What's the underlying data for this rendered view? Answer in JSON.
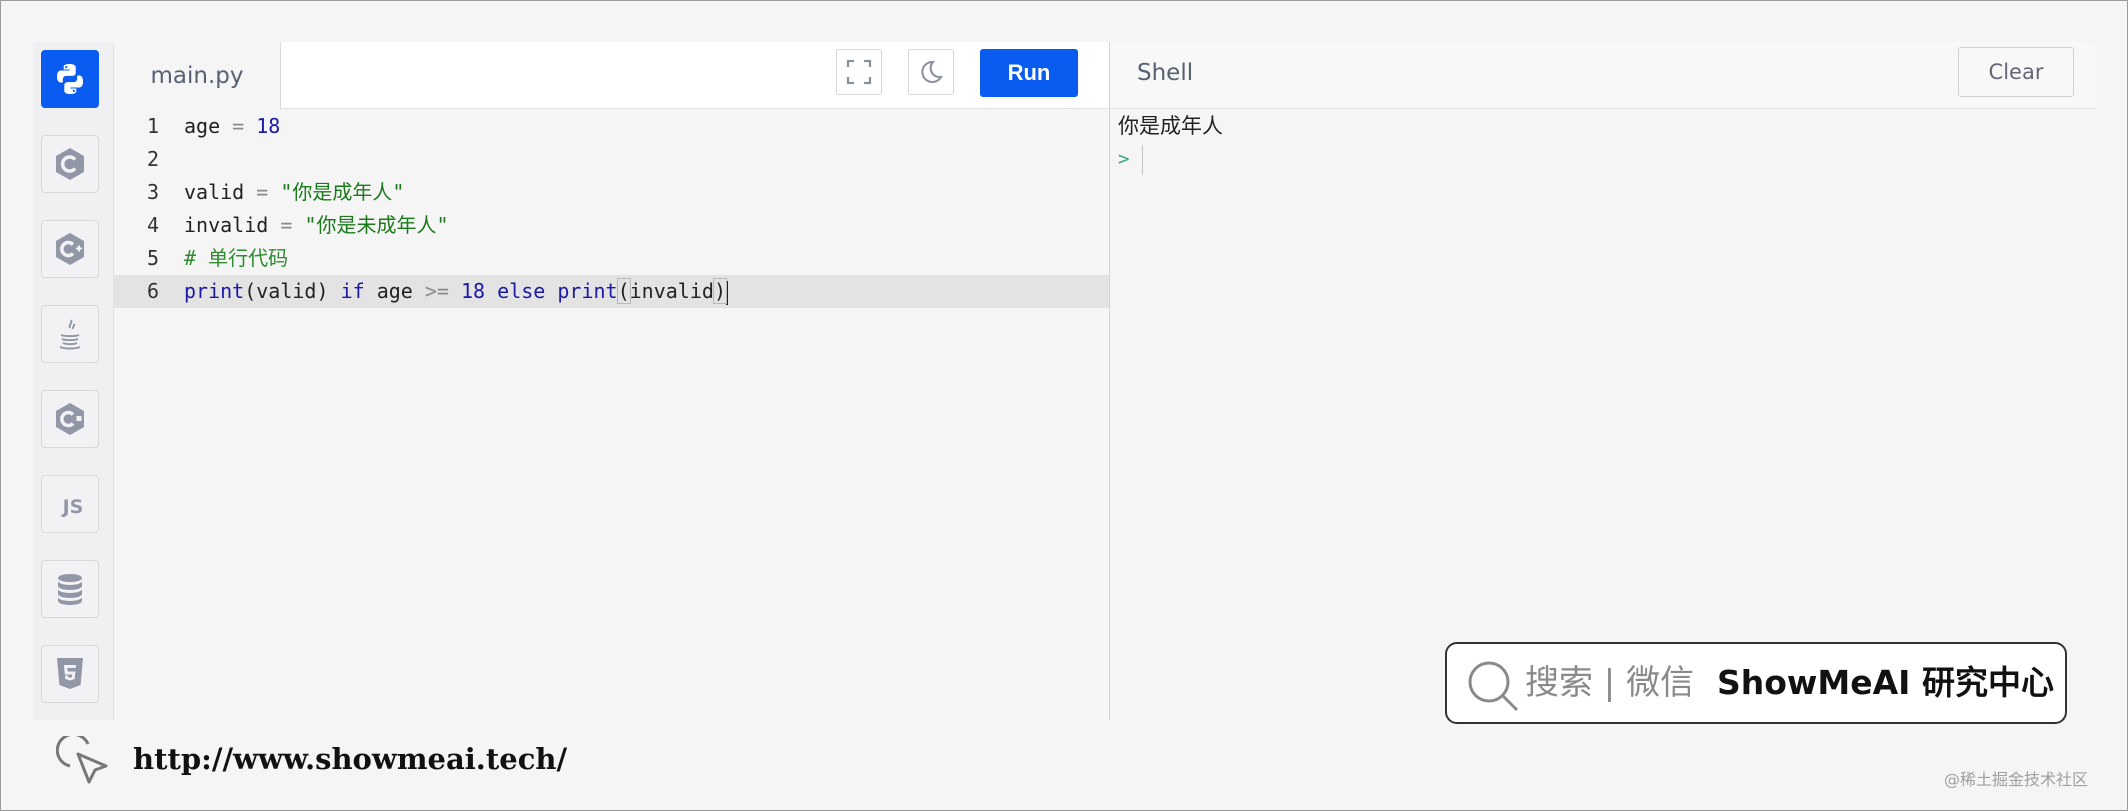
{
  "editor": {
    "tab_label": "main.py",
    "run_label": "Run",
    "lines": [
      {
        "n": "1"
      },
      {
        "n": "2"
      },
      {
        "n": "3"
      },
      {
        "n": "4"
      },
      {
        "n": "5"
      },
      {
        "n": "6"
      }
    ],
    "code": {
      "l1_var": "age",
      "l1_eq": "=",
      "l1_val": "18",
      "l3_var": "valid",
      "l3_eq": "=",
      "l3_str": "\"你是成年人\"",
      "l4_var": "invalid",
      "l4_eq": "=",
      "l4_str": "\"你是未成年人\"",
      "l5_comment": "# 单行代码",
      "l6_print1": "print",
      "l6_arg1": "(valid)",
      "l6_if": "if",
      "l6_age": "age",
      "l6_op": ">=",
      "l6_num": "18",
      "l6_else": "else",
      "l6_print2": "print",
      "l6_open": "(",
      "l6_arg2": "invalid",
      "l6_close": ")"
    }
  },
  "shell": {
    "title": "Shell",
    "clear_label": "Clear",
    "output": "你是成年人",
    "prompt": ">"
  },
  "sidebar": {
    "languages": [
      "python-icon",
      "c-icon",
      "cpp-icon",
      "java-icon",
      "csharp-icon",
      "js-icon",
      "database-icon",
      "html5-icon"
    ],
    "js_label": "JS"
  },
  "watermark": {
    "search_text": "搜索 | 微信",
    "brand_text": "ShowMeAI 研究中心",
    "url": "http://www.showmeai.tech/",
    "credit": "@稀土掘金技术社区"
  },
  "colors": {
    "accent": "#0a5bf0",
    "string": "#1b7a1b",
    "keyword": "#1a1aa6"
  }
}
